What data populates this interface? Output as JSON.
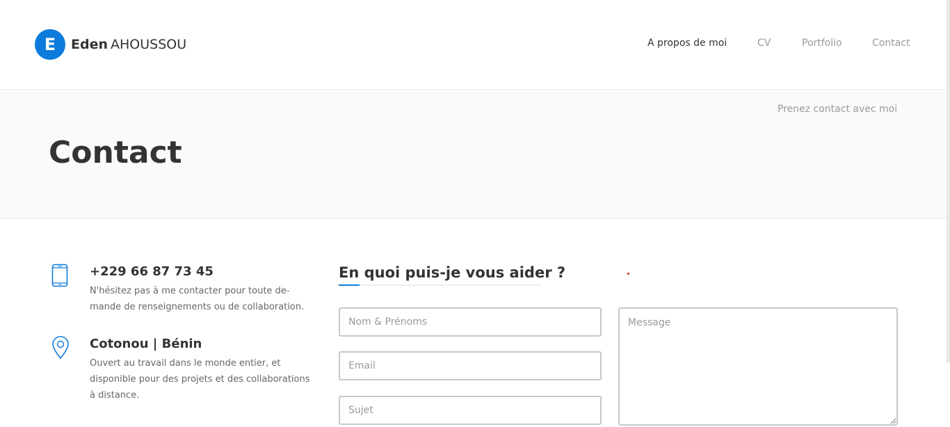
{
  "header": {
    "logo_letter": "E",
    "first_name": "Eden",
    "last_name": "AHOUSSOU",
    "nav": [
      {
        "label": "A propos de moi",
        "active": true
      },
      {
        "label": "CV",
        "active": false
      },
      {
        "label": "Portfolio",
        "active": false
      },
      {
        "label": "Contact",
        "active": false
      }
    ]
  },
  "page": {
    "title": "Contact",
    "subtitle": "Prenez contact avec moi"
  },
  "contact_info": [
    {
      "icon": "phone-icon",
      "title": "+229 66 87 73 45",
      "description": "N'hésitez pas à me contacter pour toute de-mande de renseignements ou de collaboration."
    },
    {
      "icon": "map-pin-icon",
      "title": "Cotonou | Bénin",
      "description": "Ouvert au travail dans le monde entier, et disponible pour des projets et des collaborations à distance."
    }
  ],
  "form": {
    "heading": "En quoi puis-je vous aider ?",
    "name_placeholder": "Nom & Prénoms",
    "email_placeholder": "Email",
    "subject_placeholder": "Sujet",
    "message_placeholder": "Message"
  },
  "colors": {
    "accent": "#0c7bdc",
    "text_dark": "#333333",
    "text_muted": "#9a9a9a",
    "band_bg": "#fafafa"
  }
}
